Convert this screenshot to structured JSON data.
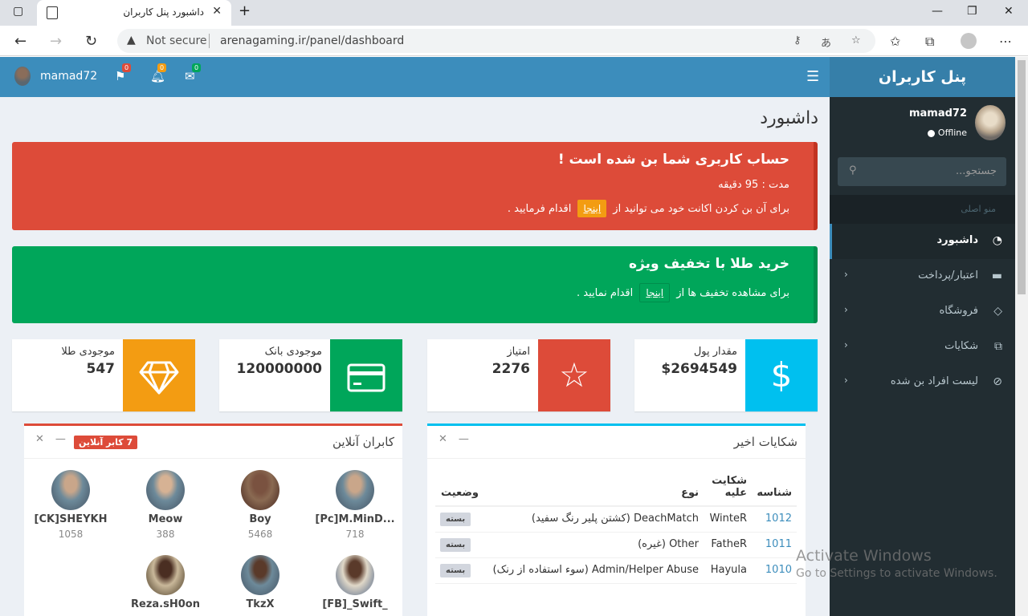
{
  "browser": {
    "tab_title": "داشبورد پنل کاربران",
    "security_label": "Not secure",
    "url": "arenagaming.ir/panel/dashboard"
  },
  "header": {
    "username": "mamad72",
    "flags_count": "0",
    "notifications_count": "0",
    "messages_count": "0"
  },
  "sidebar": {
    "logo": "پنل کاربران",
    "username": "mamad72",
    "status": "Offline",
    "search_placeholder": "جستجو...",
    "section_header": "منو اصلی",
    "items": [
      {
        "label": "داشبورد",
        "icon": "dashboard-icon"
      },
      {
        "label": "اعتبار/پرداخت",
        "icon": "credit-card-icon"
      },
      {
        "label": "فروشگاه",
        "icon": "diamond-icon"
      },
      {
        "label": "شکایات",
        "icon": "copy-icon"
      },
      {
        "label": "لیست افراد بن شده",
        "icon": "ban-icon"
      }
    ]
  },
  "page": {
    "title": "داشبورد"
  },
  "ban_alert": {
    "title": "حساب کاربری شما بن شده است !",
    "duration": "مدت : 95 دقیقه",
    "text_before": "برای آن بن کردن اکانت خود می توانید از",
    "link": "اینجا",
    "text_after": "اقدام فرمایید ."
  },
  "gold_alert": {
    "title": "خرید طلا با تخفیف ویژه",
    "text_before": "برای مشاهده تخفیف ها از",
    "link": "اینجا",
    "text_after": "اقدام نمایید ."
  },
  "stats": [
    {
      "label": "مقدار پول",
      "value": "$2694549",
      "icon": "dollar-icon",
      "color": "#00c0ef"
    },
    {
      "label": "امتیاز",
      "value": "2276",
      "icon": "star-icon",
      "color": "#dd4b39"
    },
    {
      "label": "موجودی بانک",
      "value": "120000000",
      "icon": "credit-card-icon",
      "color": "#00a65a"
    },
    {
      "label": "موجودی طلا",
      "value": "547",
      "icon": "diamond-icon",
      "color": "#f39c12"
    }
  ],
  "complaints": {
    "title": "شکایات اخیر",
    "columns": [
      "شناسه",
      "شکایت علیه",
      "نوع",
      "وضعیت"
    ],
    "rows": [
      {
        "id": "1012",
        "against": "WinteR",
        "type": "DeachMatch (کشتن پلیر رنگ سفید)",
        "status": "بسته"
      },
      {
        "id": "1011",
        "against": "FatheR",
        "type": "Other (غیره)",
        "status": "بسته"
      },
      {
        "id": "1010",
        "against": "Hayula",
        "type": "Admin/Helper Abuse (سوء استفاده از رنک)",
        "status": "بسته"
      }
    ]
  },
  "online_users": {
    "title": "کابران آنلاین",
    "badge": "7 کابر آنلاین",
    "users": [
      {
        "name": "[Pc]M.MinD...",
        "id": "718"
      },
      {
        "name": "Boy",
        "id": "5468"
      },
      {
        "name": "Meow",
        "id": "388"
      },
      {
        "name": "[CK]SHEYKH",
        "id": "1058"
      },
      {
        "name": "[FB]_Swift_",
        "id": ""
      },
      {
        "name": "TkzX",
        "id": ""
      },
      {
        "name": "Reza.sH0on",
        "id": ""
      }
    ]
  },
  "watermark": {
    "line1": "Activate Windows",
    "line2": "Go to Settings to activate Windows."
  }
}
